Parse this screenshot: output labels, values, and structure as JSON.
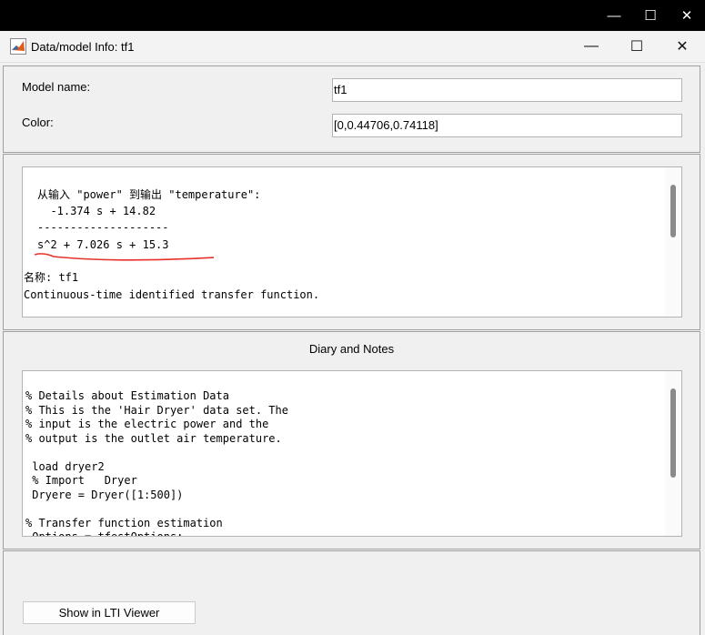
{
  "window": {
    "title": "Data/model Info: tf1",
    "outer_controls": [
      "—",
      "☐",
      "✕"
    ],
    "inner_controls": [
      "—",
      "☐",
      "✕"
    ]
  },
  "model": {
    "name_label": "Model name:",
    "name_value": "tf1",
    "color_label": "Color:",
    "color_value": "[0,0.44706,0.74118]"
  },
  "info": {
    "lines": [
      "从输入 \"power\" 到输出 \"temperature\":",
      "  -1.374 s + 14.82",
      "--------------------",
      "s^2 + 7.026 s + 15.3",
      "名称: tf1",
      "Continuous-time identified transfer function."
    ],
    "annotation_color": "#e8312b"
  },
  "diary": {
    "title": "Diary and Notes",
    "lines": [
      "% Details about Estimation Data",
      "% This is the 'Hair Dryer' data set. The",
      "% input is the electric power and the",
      "% output is the outlet air temperature.",
      "",
      " load dryer2",
      " % Import   Dryer",
      " Dryere = Dryer([1:500])",
      "",
      "% Transfer function estimation",
      " Options = tfestOptions;"
    ]
  },
  "actions": {
    "lti_viewer_label": "Show in LTI Viewer"
  }
}
